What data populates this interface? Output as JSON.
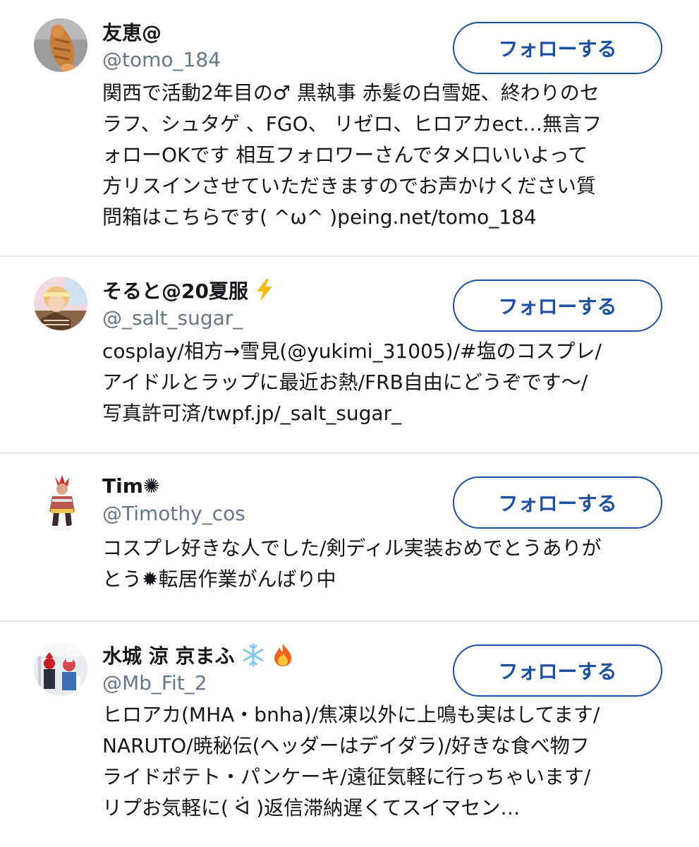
{
  "users": [
    {
      "name": "友恵@",
      "badges": [],
      "handle": "@tomo_184",
      "follow_label": "フォローする",
      "bio_lines": [
        "関西で活動2年目の♂  黒執事 赤髪の白雪姫、終わりのセ",
        "ラフ、シュタゲ 、FGO、 リゼロ、ヒロアカect…無言フ",
        "ォローOKです 相互フォロワーさんでタメ口いいよって",
        "方リスインさせていただきますのでお声かけください質",
        "問箱はこちらです( ^ω^ )peing.net/tomo_184"
      ],
      "avatar": "cat-photo-avatar"
    },
    {
      "name": "そると@20夏服",
      "badges": [
        "lightning-icon"
      ],
      "handle": "@_salt_sugar_",
      "follow_label": "フォローする",
      "bio_lines": [
        "cosplay/相方→雪見(@yukimi_31005)/#塩のコスプレ/",
        "アイドルとラップに最近お熱/FRB自由にどうぞです〜/",
        "写真許可済/twpf.jp/_salt_sugar_"
      ],
      "avatar": "cosplayer-photo-avatar"
    },
    {
      "name": "Tim✺",
      "badges": [],
      "handle": "@Timothy_cos",
      "follow_label": "フォローする",
      "bio_lines": [
        "コスプレ好きな人でした/剣ディル実装おめでとうありが",
        "とう✹転居作業がんばり中"
      ],
      "avatar": "red-hair-cosplayer-avatar"
    },
    {
      "name": "水城 涼 京まふ",
      "badges": [
        "snowflake-icon",
        "fire-icon"
      ],
      "handle": "@Mb_Fit_2",
      "follow_label": "フォローする",
      "bio_lines": [
        "ヒロアカ(MHA・bnha)/焦凍以外に上鳴も実はしてます/",
        "NARUTO/暁秘伝(ヘッダーはデイダラ)/好きな食べ物フ",
        "ライドポテト・パンケーキ/遠征気軽に行っちゃいます/",
        "リプお気軽に( ᐛ )返信滞納遅くてスイマセン…"
      ],
      "avatar": "group-cosplayer-avatar"
    }
  ],
  "colors": {
    "accent": "#1d4fa3",
    "handle": "#657786",
    "text": "#14171a",
    "divider": "#e1e5e8"
  }
}
